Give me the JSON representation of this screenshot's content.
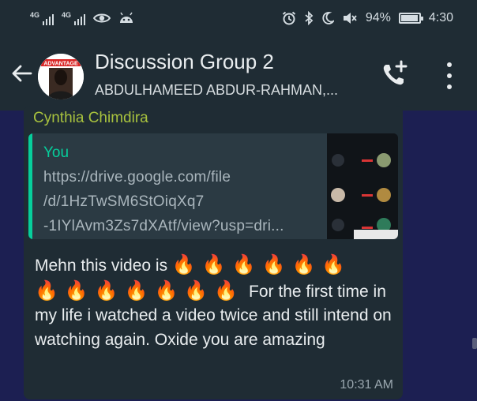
{
  "status_bar": {
    "network_1": "4G",
    "network_2": "4G",
    "battery": "94%",
    "battery_level": 0.94,
    "time": "4:30",
    "icons": [
      "signal-icon",
      "signal-icon",
      "eye-icon",
      "android-icon",
      "alarm-icon",
      "bluetooth-icon",
      "moon-icon",
      "mute-icon",
      "battery-icon"
    ]
  },
  "header": {
    "title": "Discussion Group 2",
    "subtitle": "ABDULHAMEED ABDUR-RAHMAN,...",
    "avatar_logo_text": "ADVANTAGE",
    "icons": [
      "back-arrow-icon",
      "add-call-icon",
      "more-vert-icon"
    ]
  },
  "message": {
    "sender": "Cynthia Chimdira",
    "quote": {
      "author": "You",
      "line1": "https://drive.google.com/file",
      "line2": "/d/1HzTwSM6StOiqXq7",
      "line3": "-1IYlAvm3Zs7dXAtf/view?usp=dri..."
    },
    "text_before": "Mehn this video is ",
    "fire_group_1": "🔥🔥🔥🔥🔥🔥",
    "fire_group_2": "🔥🔥🔥🔥🔥🔥🔥",
    "text_after": " For the first time in my life i watched a video twice and still intend on watching again.   Oxide you are amazing",
    "time": "10:31 AM"
  },
  "colors": {
    "background": "#1c1f52",
    "bar": "#1f2c34",
    "bubble": "#1f2c34",
    "quote_bg": "#2b3a43",
    "quote_accent": "#06cf9c",
    "sender_name": "#a8c23e"
  }
}
